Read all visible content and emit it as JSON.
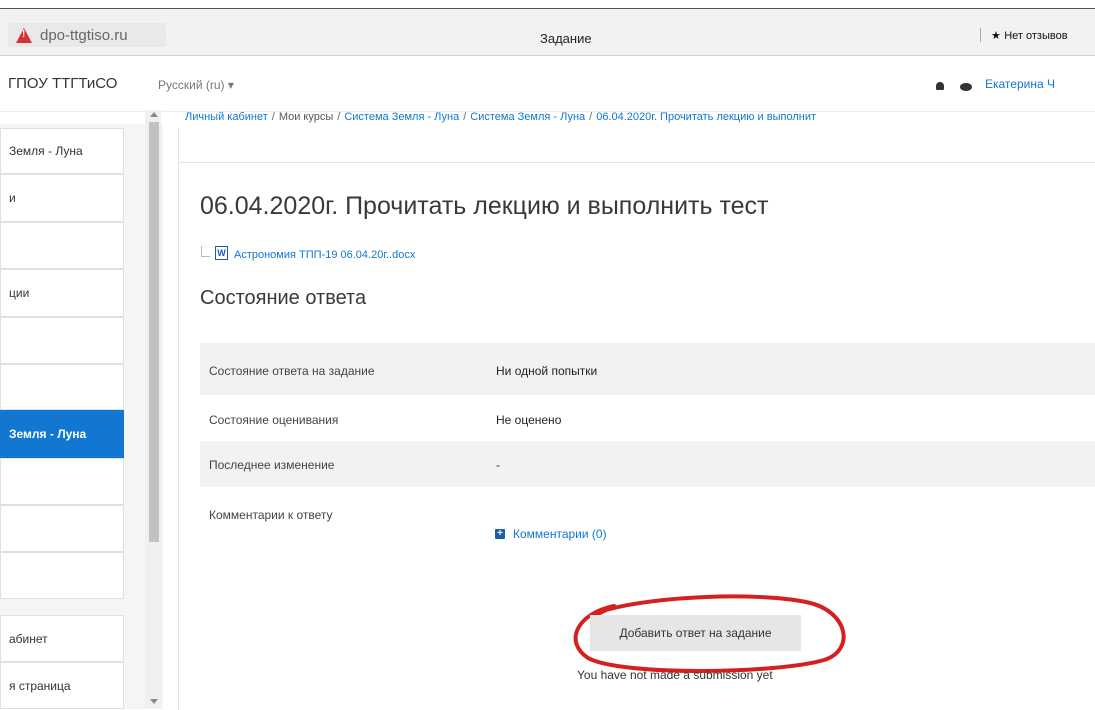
{
  "browser": {
    "url": "dpo-ttgtiso.ru",
    "page_title": "Задание",
    "reviews_label": "Нет отзывов"
  },
  "navbar": {
    "site_name": "ГПОУ ТТГТиСО",
    "language": "Русский (ru) ▾",
    "user_name": "Екатерина Ч"
  },
  "sidebar": {
    "items": [
      {
        "label": "Земля - Луна",
        "active": false
      },
      {
        "label": "и",
        "active": false
      },
      {
        "label": "",
        "active": false
      },
      {
        "label": "ции",
        "active": false
      },
      {
        "label": "",
        "active": false
      },
      {
        "label": "",
        "active": false
      },
      {
        "label": "Земля - Луна",
        "active": true
      },
      {
        "label": "",
        "active": false
      },
      {
        "label": "",
        "active": false
      },
      {
        "label": "",
        "active": false
      },
      {
        "label": "абинет",
        "active": false
      },
      {
        "label": "я страница",
        "active": false
      }
    ]
  },
  "breadcrumb": {
    "home": "Личный кабинет",
    "courses": "Мои курсы",
    "course": "Система Земля - Луна",
    "section": "Система Земля - Луна",
    "current": "06.04.2020г. Прочитать лекцию и выполнит"
  },
  "assignment": {
    "title": "06.04.2020г. Прочитать лекцию и выполнить тест",
    "file_icon": "W",
    "file_name": "Астрономия ТПП-19 06.04.20г..docx"
  },
  "status": {
    "heading": "Состояние ответа",
    "rows": [
      {
        "label": "Состояние ответа на задание",
        "value": "Ни одной попытки"
      },
      {
        "label": "Состояние оценивания",
        "value": "Не оценено"
      },
      {
        "label": "Последнее изменение",
        "value": "-"
      },
      {
        "label": "Комментарии к ответу",
        "value": "Комментарии (0)"
      }
    ]
  },
  "actions": {
    "add_submission": "Добавить ответ на задание",
    "no_submission": "You have not made a submission yet"
  },
  "colors": {
    "link": "#1177d1",
    "active_sidebar": "#1177d1",
    "annotation_circle": "#d42020"
  }
}
